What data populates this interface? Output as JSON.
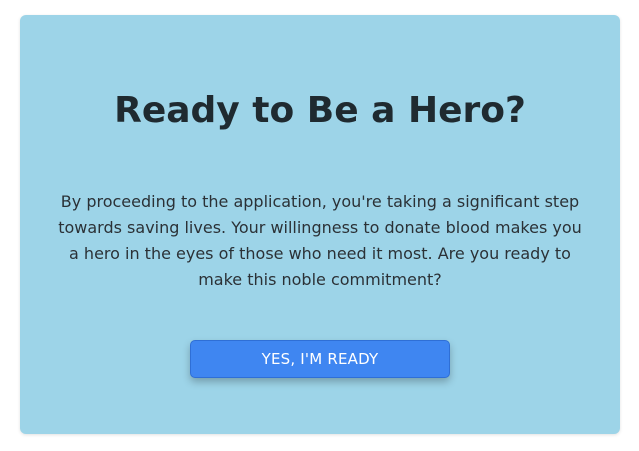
{
  "card": {
    "title": "Ready to Be a Hero?",
    "description": "By proceeding to the application, you're taking a significant step towards saving lives. Your willingness to donate blood makes you a hero in the eyes of those who need it most. Are you ready to make this noble commitment?",
    "cta_label": "YES, I'M READY"
  },
  "colors": {
    "card_background": "#9dd4e8",
    "button_background": "#3f86f1",
    "title_text": "#1f2a30"
  }
}
